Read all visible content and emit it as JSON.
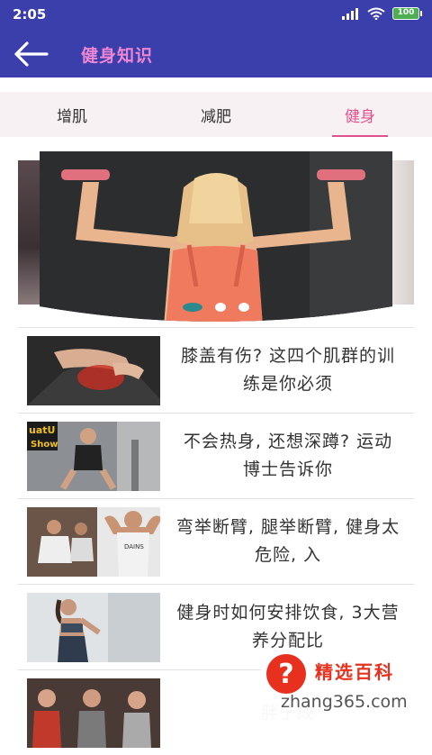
{
  "status_bar": {
    "time": "2:05",
    "battery": "100",
    "icons": [
      "signal-icon",
      "wifi-icon",
      "battery-icon"
    ]
  },
  "app_bar": {
    "title": "健身知识",
    "back_icon": "arrow-left-icon"
  },
  "tabs": [
    {
      "label": "增肌",
      "active": false
    },
    {
      "label": "减肥",
      "active": false
    },
    {
      "label": "健身",
      "active": true
    }
  ],
  "banner": {
    "page_count": 3,
    "active_index": 0
  },
  "articles": [
    {
      "title": "膝盖有伤? 这四个肌群的训练是你必须"
    },
    {
      "title": "不会热身, 还想深蹲? 运动博士告诉你"
    },
    {
      "title": "弯举断臂, 腿举断臂, 健身太危险, 入"
    },
    {
      "title": "健身时如何安排饮食, 3大营养分配比"
    },
    {
      "title": "胖子成"
    }
  ],
  "watermark": {
    "brand": "精选百科",
    "domain": "zhang365.com",
    "icon": "question-mark"
  },
  "colors": {
    "primary": "#3a3fab",
    "title_pink": "#ee86d4",
    "accent": "#e0508c"
  }
}
